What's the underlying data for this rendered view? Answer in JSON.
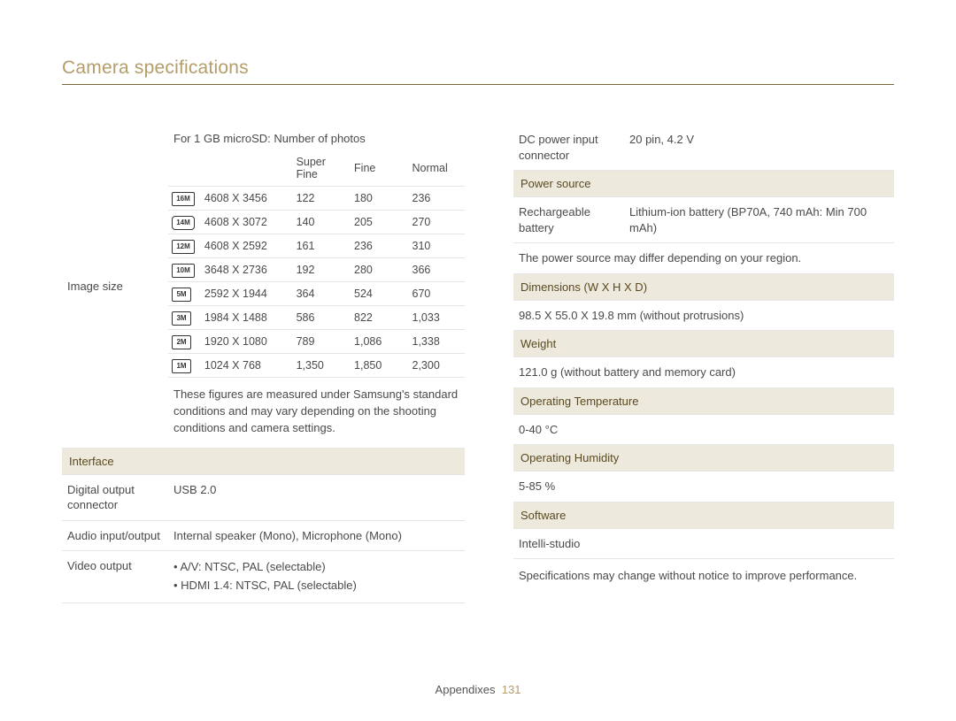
{
  "title": "Camera specifications",
  "image_size": {
    "label": "Image size",
    "caption": "For 1 GB microSD: Number of photos",
    "headers": [
      "Super Fine",
      "Fine",
      "Normal"
    ],
    "rows": [
      {
        "icon": "16M",
        "res": "4608 X 3456",
        "sf": "122",
        "f": "180",
        "n": "236"
      },
      {
        "icon": "14M",
        "res": "4608 X 3072",
        "sf": "140",
        "f": "205",
        "n": "270"
      },
      {
        "icon": "12M",
        "res": "4608 X 2592",
        "sf": "161",
        "f": "236",
        "n": "310"
      },
      {
        "icon": "10M",
        "res": "3648 X 2736",
        "sf": "192",
        "f": "280",
        "n": "366"
      },
      {
        "icon": "5M",
        "res": "2592 X 1944",
        "sf": "364",
        "f": "524",
        "n": "670"
      },
      {
        "icon": "3M",
        "res": "1984 X 1488",
        "sf": "586",
        "f": "822",
        "n": "1,033"
      },
      {
        "icon": "2M",
        "res": "1920 X 1080",
        "sf": "789",
        "f": "1,086",
        "n": "1,338"
      },
      {
        "icon": "1M",
        "res": "1024 X 768",
        "sf": "1,350",
        "f": "1,850",
        "n": "2,300"
      }
    ],
    "note": "These figures are measured under Samsung's standard conditions and may vary depending on the shooting conditions and camera settings."
  },
  "interface": {
    "header": "Interface",
    "digital_output": {
      "label": "Digital output connector",
      "value": "USB 2.0"
    },
    "audio": {
      "label": "Audio input/output",
      "value": "Internal speaker (Mono), Microphone (Mono)"
    },
    "video": {
      "label": "Video output",
      "bullets": [
        "A/V: NTSC, PAL (selectable)",
        "HDMI 1.4: NTSC, PAL (selectable)"
      ]
    }
  },
  "right": {
    "dc_power": {
      "label": "DC power input connector",
      "value": "20 pin, 4.2 V"
    },
    "power_source": {
      "header": "Power source",
      "battery": {
        "label": "Rechargeable battery",
        "value": "Lithium-ion battery (BP70A, 740 mAh: Min 700 mAh)"
      },
      "note": "The power source may differ depending on your region."
    },
    "dimensions": {
      "header": "Dimensions (W X H X D)",
      "value": "98.5 X 55.0 X 19.8 mm (without protrusions)"
    },
    "weight": {
      "header": "Weight",
      "value": "121.0 g (without battery and memory card)"
    },
    "op_temp": {
      "header": "Operating Temperature",
      "value": "0-40 °C"
    },
    "op_humidity": {
      "header": "Operating Humidity",
      "value": "5-85 %"
    },
    "software": {
      "header": "Software",
      "value": "Intelli-studio"
    },
    "disclaimer": "Specifications may change without notice to improve performance."
  },
  "footer": {
    "section": "Appendixes",
    "page": "131"
  }
}
